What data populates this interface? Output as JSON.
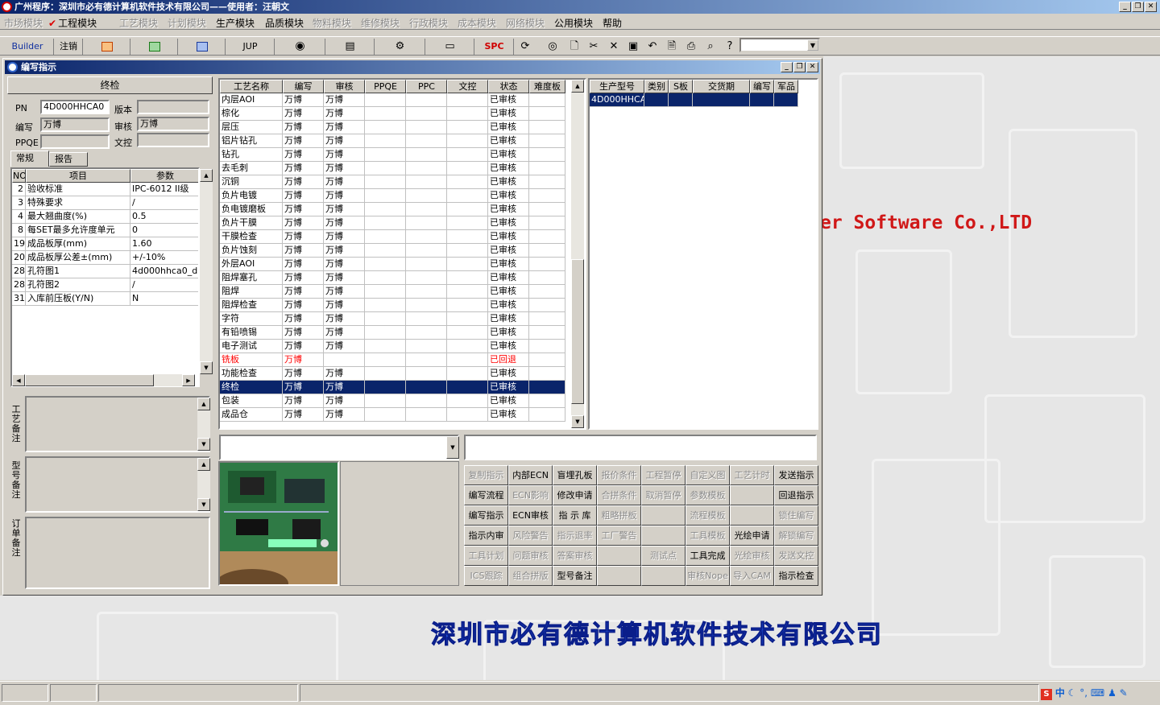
{
  "app": {
    "title": "广州程序：深圳市必有德计算机软件技术有限公司——使用者：汪朝文"
  },
  "menu": [
    {
      "label": "市场模块",
      "enabled": false
    },
    {
      "label": "工程模块",
      "enabled": true,
      "checked": true
    },
    {
      "label": "工艺模块",
      "enabled": false
    },
    {
      "label": "计划模块",
      "enabled": false
    },
    {
      "label": "生产模块",
      "enabled": true
    },
    {
      "label": "品质模块",
      "enabled": true
    },
    {
      "label": "物料模块",
      "enabled": false
    },
    {
      "label": "维修模块",
      "enabled": false
    },
    {
      "label": "行政模块",
      "enabled": false
    },
    {
      "label": "成本模块",
      "enabled": false
    },
    {
      "label": "网络模块",
      "enabled": false
    },
    {
      "label": "公用模块",
      "enabled": true
    },
    {
      "label": "帮助",
      "enabled": true
    }
  ],
  "toolbar": {
    "builder": "Builder",
    "logout": "注销",
    "jup": "JUP",
    "spc": "SPC"
  },
  "window": {
    "title": "编写指示"
  },
  "left": {
    "process_name": "终检",
    "pn_label": "PN",
    "pn_value": "4D000HHCA0",
    "version_label": "版本",
    "version_value": "",
    "author_label": "编写",
    "author_value": "万博",
    "reviewer_label": "审核",
    "reviewer_value": "万博",
    "ppqe_label": "PPQE",
    "ppqe_value": "",
    "wenkong_label": "文控",
    "wenkong_value": "",
    "tabs": [
      "常规",
      "报告"
    ],
    "table_headers": [
      "NO",
      "项目",
      "参数"
    ],
    "rows": [
      [
        "2",
        "验收标准",
        "IPC-6012 II级"
      ],
      [
        "3",
        "特殊要求",
        "/"
      ],
      [
        "4",
        "最大翘曲度(%)",
        "0.5"
      ],
      [
        "8",
        "每SET最多允许度单元",
        "0"
      ],
      [
        "19",
        "成品板厚(mm)",
        "1.60"
      ],
      [
        "20",
        "成品板厚公差±(mm)",
        "+/-10%"
      ],
      [
        "28",
        "孔符图1",
        "4d000hhca0_dr"
      ],
      [
        "28",
        "孔符图2",
        "/"
      ],
      [
        "31",
        "入库前压板(Y/N)",
        "N"
      ]
    ],
    "note_labels": [
      "工艺备注",
      "型号备注",
      "订单备注"
    ]
  },
  "process_table": {
    "headers": [
      "工艺名称",
      "编写",
      "审核",
      "PPQE",
      "PPC",
      "文控",
      "状态",
      "难度板"
    ],
    "rows": [
      {
        "name": "内层AOI",
        "author": "万博",
        "reviewer": "万博",
        "status": "已审核"
      },
      {
        "name": "棕化",
        "author": "万博",
        "reviewer": "万博",
        "status": "已审核"
      },
      {
        "name": "层压",
        "author": "万博",
        "reviewer": "万博",
        "status": "已审核"
      },
      {
        "name": "铝片钻孔",
        "author": "万博",
        "reviewer": "万博",
        "status": "已审核"
      },
      {
        "name": "钻孔",
        "author": "万博",
        "reviewer": "万博",
        "status": "已审核"
      },
      {
        "name": "去毛刺",
        "author": "万博",
        "reviewer": "万博",
        "status": "已审核"
      },
      {
        "name": "沉铜",
        "author": "万博",
        "reviewer": "万博",
        "status": "已审核"
      },
      {
        "name": "负片电镀",
        "author": "万博",
        "reviewer": "万博",
        "status": "已审核"
      },
      {
        "name": "负电镀磨板",
        "author": "万博",
        "reviewer": "万博",
        "status": "已审核"
      },
      {
        "name": "负片干膜",
        "author": "万博",
        "reviewer": "万博",
        "status": "已审核"
      },
      {
        "name": "干膜检查",
        "author": "万博",
        "reviewer": "万博",
        "status": "已审核"
      },
      {
        "name": "负片蚀刻",
        "author": "万博",
        "reviewer": "万博",
        "status": "已审核"
      },
      {
        "name": "外层AOI",
        "author": "万博",
        "reviewer": "万博",
        "status": "已审核"
      },
      {
        "name": "阻焊塞孔",
        "author": "万博",
        "reviewer": "万博",
        "status": "已审核"
      },
      {
        "name": "阻焊",
        "author": "万博",
        "reviewer": "万博",
        "status": "已审核"
      },
      {
        "name": "阻焊检查",
        "author": "万博",
        "reviewer": "万博",
        "status": "已审核"
      },
      {
        "name": "字符",
        "author": "万博",
        "reviewer": "万博",
        "status": "已审核"
      },
      {
        "name": "有铅喷锡",
        "author": "万博",
        "reviewer": "万博",
        "status": "已审核"
      },
      {
        "name": "电子测试",
        "author": "万博",
        "reviewer": "万博",
        "status": "已审核"
      },
      {
        "name": "铣板",
        "author": "万博",
        "reviewer": "",
        "status": "已回退",
        "returned": true
      },
      {
        "name": "功能检查",
        "author": "万博",
        "reviewer": "万博",
        "status": "已审核"
      },
      {
        "name": "终检",
        "author": "万博",
        "reviewer": "万博",
        "status": "已审核",
        "selected": true
      },
      {
        "name": "包装",
        "author": "万博",
        "reviewer": "万博",
        "status": "已审核"
      },
      {
        "name": "成品仓",
        "author": "万博",
        "reviewer": "万博",
        "status": "已审核"
      }
    ]
  },
  "model_table": {
    "headers": [
      "生产型号",
      "类别",
      "S板",
      "交货期",
      "编写",
      "军品"
    ],
    "rows": [
      [
        "4D000HHCA0",
        "",
        "",
        "",
        "",
        ""
      ]
    ]
  },
  "buttons": [
    [
      {
        "l": "复制指示",
        "e": false
      },
      {
        "l": "内部ECN",
        "e": true
      },
      {
        "l": "盲埋孔板",
        "e": true
      },
      {
        "l": "报价条件",
        "e": false
      },
      {
        "l": "工程暂停",
        "e": false
      },
      {
        "l": "自定义图",
        "e": false
      },
      {
        "l": "工艺计时",
        "e": false
      },
      {
        "l": "发送指示",
        "e": true
      }
    ],
    [
      {
        "l": "编写流程",
        "e": true
      },
      {
        "l": "ECN影响",
        "e": false
      },
      {
        "l": "修改申请",
        "e": true
      },
      {
        "l": "合拼条件",
        "e": false
      },
      {
        "l": "取消暂停",
        "e": false
      },
      {
        "l": "参数模板",
        "e": false
      },
      {
        "l": "",
        "e": false
      },
      {
        "l": "回退指示",
        "e": true
      }
    ],
    [
      {
        "l": "编写指示",
        "e": true
      },
      {
        "l": "ECN审核",
        "e": true
      },
      {
        "l": "指 示 库",
        "e": true
      },
      {
        "l": "粗略拼板",
        "e": false
      },
      {
        "l": "",
        "e": false
      },
      {
        "l": "流程模板",
        "e": false
      },
      {
        "l": "",
        "e": false
      },
      {
        "l": "锁住编写",
        "e": false
      }
    ],
    [
      {
        "l": "指示内审",
        "e": true
      },
      {
        "l": "风险警告",
        "e": false
      },
      {
        "l": "指示退率",
        "e": false
      },
      {
        "l": "工厂警告",
        "e": false
      },
      {
        "l": "",
        "e": false
      },
      {
        "l": "工具模板",
        "e": false
      },
      {
        "l": "光绘申请",
        "e": true
      },
      {
        "l": "解锁编写",
        "e": false
      }
    ],
    [
      {
        "l": "工具计划",
        "e": false
      },
      {
        "l": "问题审核",
        "e": false
      },
      {
        "l": "答案审核",
        "e": false
      },
      {
        "l": "",
        "e": false
      },
      {
        "l": "测试点",
        "e": false
      },
      {
        "l": "工具完成",
        "e": true
      },
      {
        "l": "光绘审核",
        "e": false
      },
      {
        "l": "发送文控",
        "e": false
      }
    ],
    [
      {
        "l": "ICS跟踪",
        "e": false
      },
      {
        "l": "组合拼版",
        "e": false
      },
      {
        "l": "型号备注",
        "e": true
      },
      {
        "l": "",
        "e": false
      },
      {
        "l": "",
        "e": false
      },
      {
        "l": "审核Nope",
        "e": false
      },
      {
        "l": "导入CAM",
        "e": false
      },
      {
        "l": "指示检查",
        "e": true
      }
    ]
  ],
  "desktop": {
    "brand_en": "er Software Co.,LTD",
    "brand_cn": "深圳市必有德计算机软件技术有限公司"
  },
  "tray": {
    "ime": "中"
  }
}
